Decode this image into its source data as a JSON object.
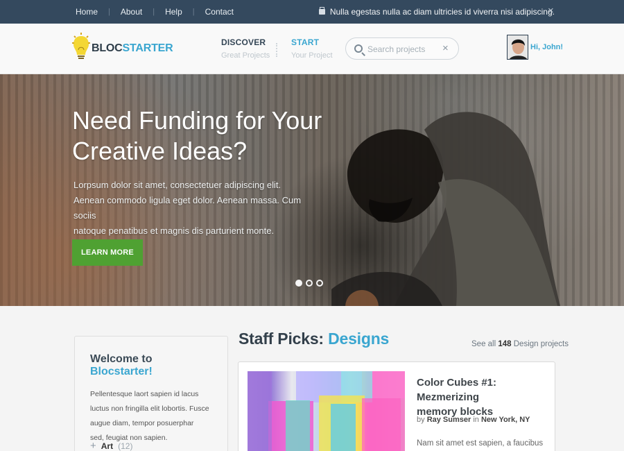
{
  "topbar": {
    "links": [
      "Home",
      "About",
      "Help",
      "Contact"
    ],
    "notice": "Nulla egestas nulla ac diam ultricies id viverra nisi adipiscing.",
    "close": "×"
  },
  "header": {
    "logo": {
      "part1": "BLOC",
      "part2": "STARTER"
    },
    "discover": {
      "title": "DISCOVER",
      "subtitle": "Great Projects"
    },
    "start": {
      "title": "START",
      "subtitle": "Your Project"
    },
    "search": {
      "placeholder": "Search projects",
      "clear": "×"
    },
    "greeting": "Hi, John!"
  },
  "hero": {
    "title_line1": "Need Funding for Your",
    "title_line2": "Creative Ideas?",
    "text_line1": "Lorpsum dolor sit amet, consectetuer adipiscing elit.",
    "text_line2": "Aenean commodo ligula eget dolor. Aenean massa. Cum sociis",
    "text_line3": "natoque penatibus et magnis dis parturient monte.",
    "button": "LEARN MORE",
    "slides_total": 3,
    "slide_active": 1
  },
  "sidebar": {
    "title_prefix": "Welcome to ",
    "title_brand": "Blocstarter!",
    "line1": "Pellentesque laort sapien id lacus",
    "line2": "luctus non fringilla elit lobortis. Fusce",
    "line3": "augue diam, tempor posuerphar",
    "line4": "sed, feugiat non sapien.",
    "category": {
      "name": "Art",
      "count": "(12)"
    }
  },
  "staff_picks": {
    "title": "Staff Picks: ",
    "accent": "Designs",
    "see_all_prefix": "See all ",
    "count": "148",
    "see_all_suffix": " Design  projects",
    "card": {
      "title_line1": "Color Cubes #1: Mezmerizing",
      "title_line2": "memory blocks",
      "by": "by ",
      "author": "Ray Sumser",
      "in": " in ",
      "location": "New York, NY",
      "description": "Nam sit amet est sapien, a faucibus"
    }
  },
  "colors": {
    "topbar": "#34495e",
    "accent": "#3aa6d0",
    "button": "#4fa132",
    "logo_dark": "#2e3d49"
  }
}
